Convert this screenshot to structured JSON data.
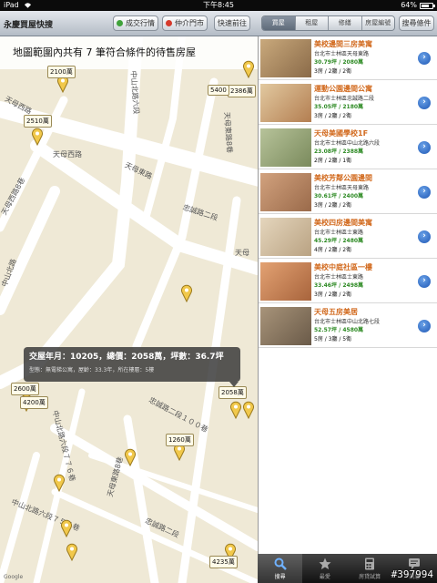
{
  "status": {
    "device": "iPad",
    "time": "下午8:45",
    "battery": "64%"
  },
  "toolbar": {
    "app_title": "永慶買屋快搜",
    "deal_button": "成交行情",
    "agency_button": "仲介門市",
    "quick_button": "快速前往",
    "segments": [
      "買屋",
      "租屋",
      "修繕",
      "房屋編號"
    ],
    "active_segment": 0,
    "filter_button": "搜尋條件"
  },
  "map": {
    "banner": "地圖範圍內共有 7 筆符合條件的待售房屋",
    "road_labels": [
      "天母西路",
      "天母西路",
      "天母東路",
      "忠誠路二段",
      "天母東路8巷",
      "中山北路六段",
      "中山北路",
      "天母西路8巷",
      "天母",
      "中山北路六段７７６巷",
      "中山北路六段７５４巷",
      "天母東路8巷",
      "忠誠路二段１００巷",
      "忠誠路二段"
    ],
    "price_tags": [
      "2100萬",
      "2386萬",
      "5400",
      "2510萬",
      "2600萬",
      "4200萬",
      "2058萬",
      "1260萬",
      "4235萬"
    ],
    "tooltip": {
      "line1": "交屋年月：10205，總價：2058萬，坪數：36.7坪",
      "line2": "型態：無電梯公寓，屋齡：33.3年，所在樓層：5樓"
    },
    "google": "Google"
  },
  "listings": [
    {
      "title": "美校邊間三房美寓",
      "addr": "台北市士林區天母東路",
      "price": "30.79坪 / 2080萬",
      "rooms": "3房 / 2廳 / 2衛",
      "thumb": "#8a6a48"
    },
    {
      "title": "運動公園邊間公寓",
      "addr": "台北市士林區忠誠路二段",
      "price": "35.05坪 / 2180萬",
      "rooms": "3房 / 2廳 / 2衛",
      "thumb": "#b37e51"
    },
    {
      "title": "天母美國學校1F",
      "addr": "台北市士林區中山北路六段",
      "price": "23.08坪 / 2388萬",
      "rooms": "2房 / 2廳 / 1衛",
      "thumb": "#7a8a5c"
    },
    {
      "title": "美校芳鄰公園邊間",
      "addr": "台北市士林區天母東路",
      "price": "30.61坪 / 2400萬",
      "rooms": "3房 / 2廳 / 2衛",
      "thumb": "#9a6a4a"
    },
    {
      "title": "美校四房邊間美寓",
      "addr": "台北市士林區士東路",
      "price": "45.29坪 / 2480萬",
      "rooms": "4房 / 2廳 / 2衛",
      "thumb": "#b9a282"
    },
    {
      "title": "美校中庭社區一樓",
      "addr": "台北市士林區士東路",
      "price": "33.46坪 / 2498萬",
      "rooms": "3房 / 2廳 / 2衛",
      "thumb": "#a8643c"
    },
    {
      "title": "天母五房美居",
      "addr": "台北市士林區中山北路七段",
      "price": "52.57坪 / 4580萬",
      "rooms": "5房 / 3廳 / 5衛",
      "thumb": "#6a5a48"
    }
  ],
  "tabbar": [
    "搜尋",
    "最愛",
    "房貸試算",
    "訊息"
  ],
  "watermark": "#397994"
}
